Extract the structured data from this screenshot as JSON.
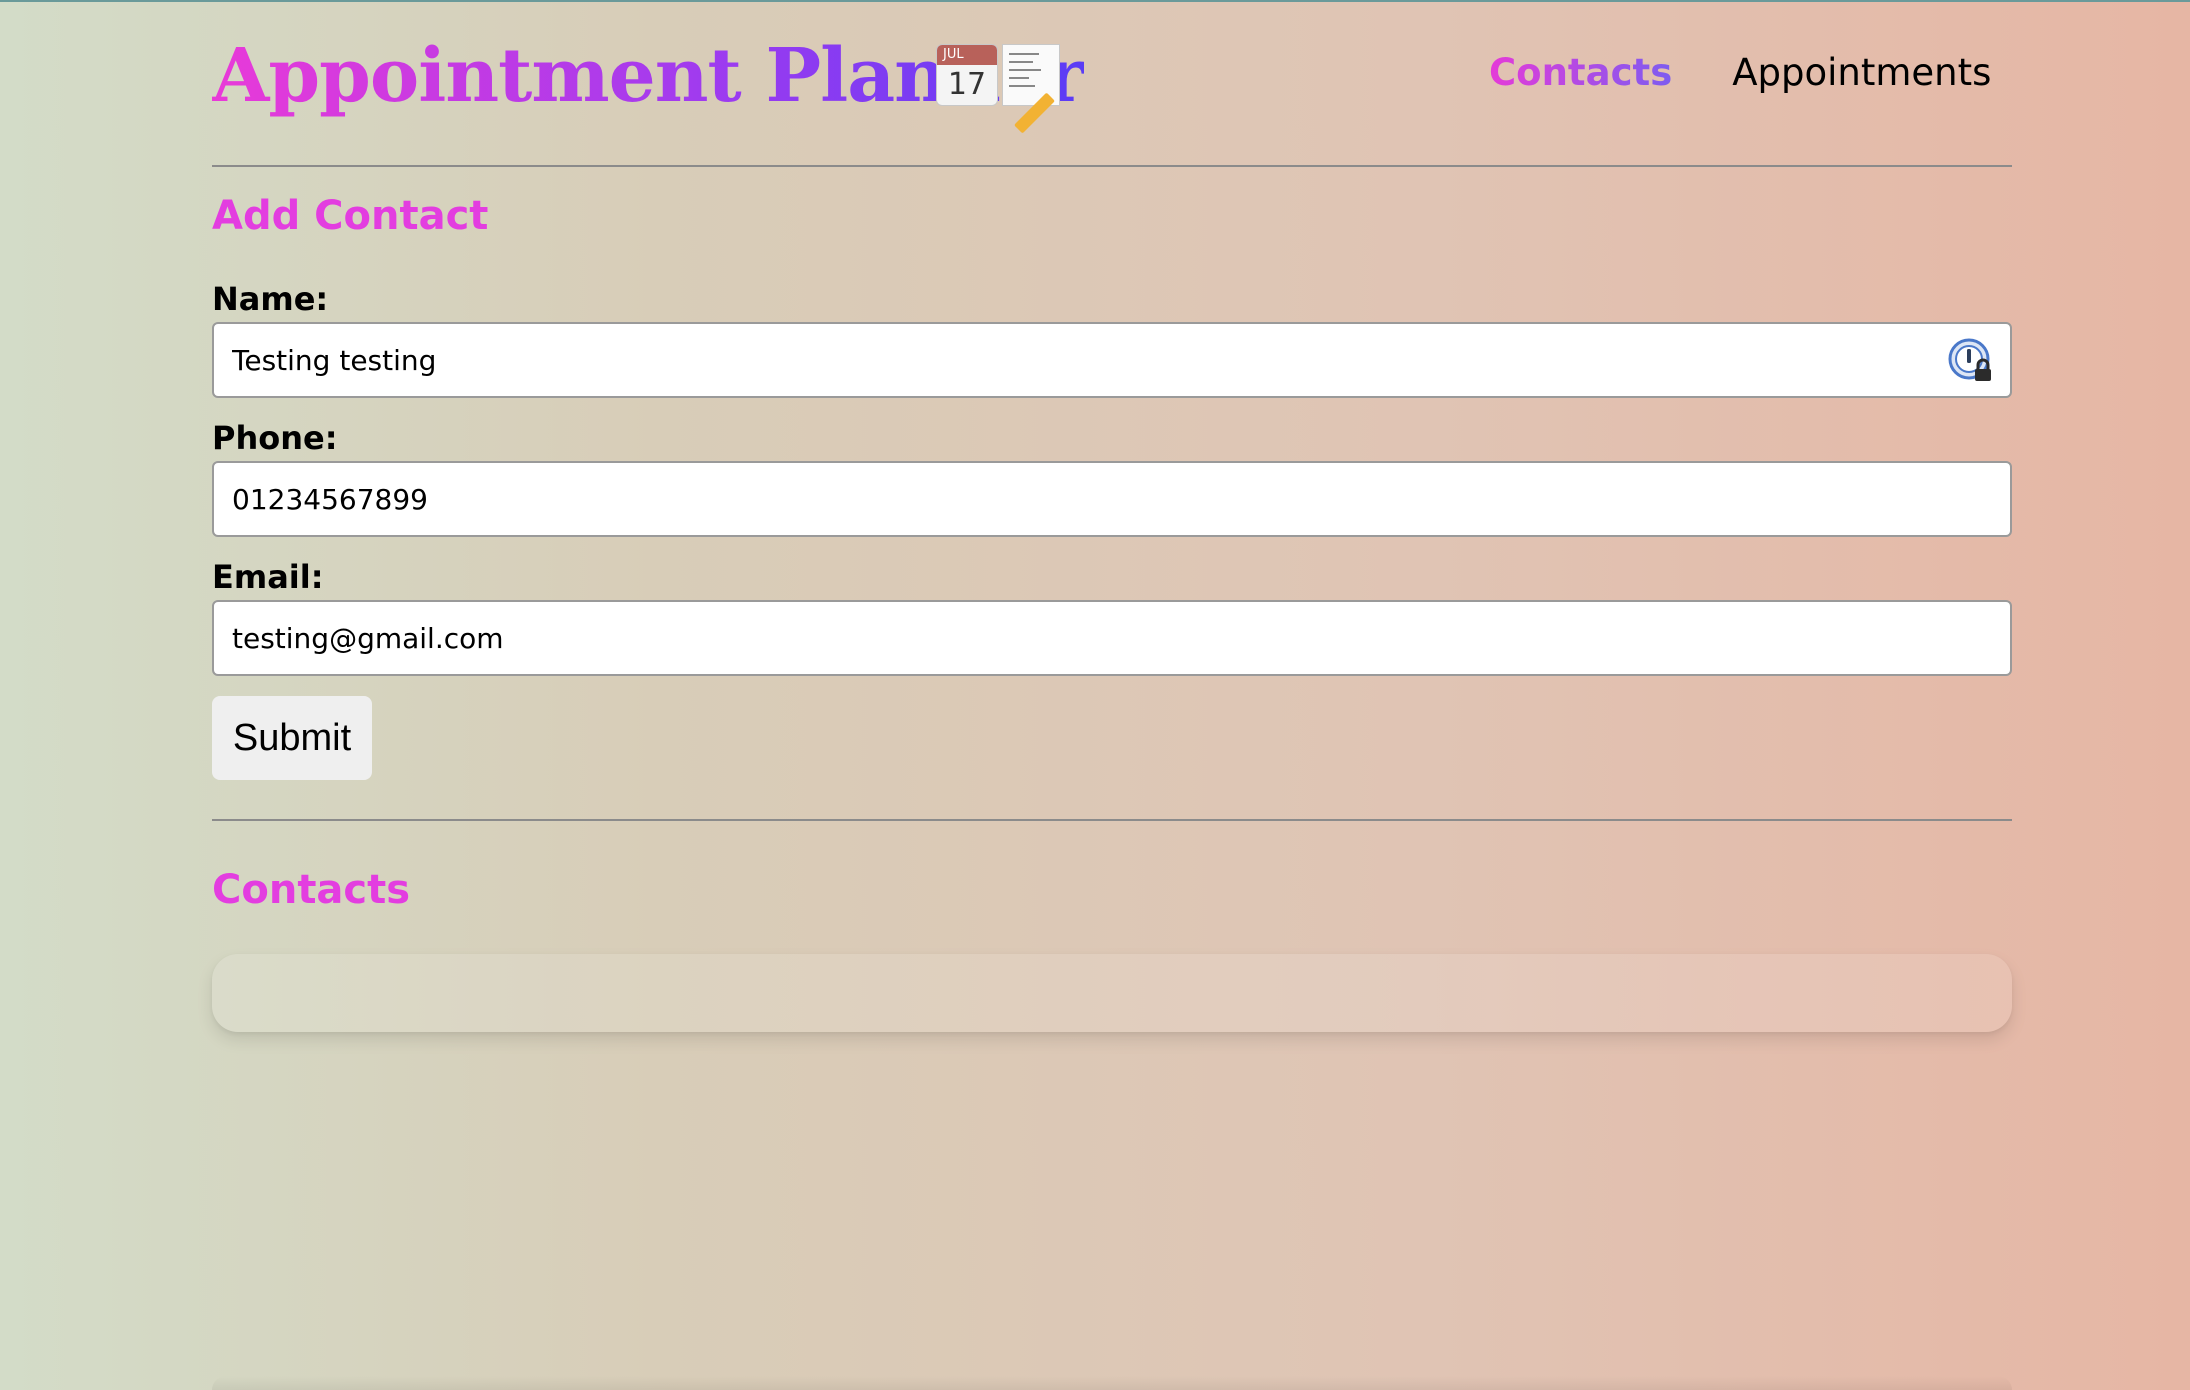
{
  "header": {
    "title": "Appointment Planner",
    "title_icons": [
      "calendar-icon",
      "memo-icon"
    ],
    "calendar_icon": {
      "month": "JUL",
      "day": "17"
    },
    "nav": {
      "contacts_label": "Contacts",
      "appointments_label": "Appointments",
      "active": "Contacts"
    }
  },
  "form": {
    "title": "Add Contact",
    "name_label": "Name:",
    "name_value": "Testing testing",
    "phone_label": "Phone:",
    "phone_value": "01234567899",
    "email_label": "Email:",
    "email_value": "testing@gmail.com",
    "submit_label": "Submit",
    "password_manager_icon": "password-manager-icon"
  },
  "contacts": {
    "title": "Contacts",
    "items": []
  },
  "colors": {
    "accent_pink": "#e33de0",
    "accent_purple": "#5a3cf5",
    "bg_left": "#d3dcc8",
    "bg_right": "#e6b6a4"
  }
}
